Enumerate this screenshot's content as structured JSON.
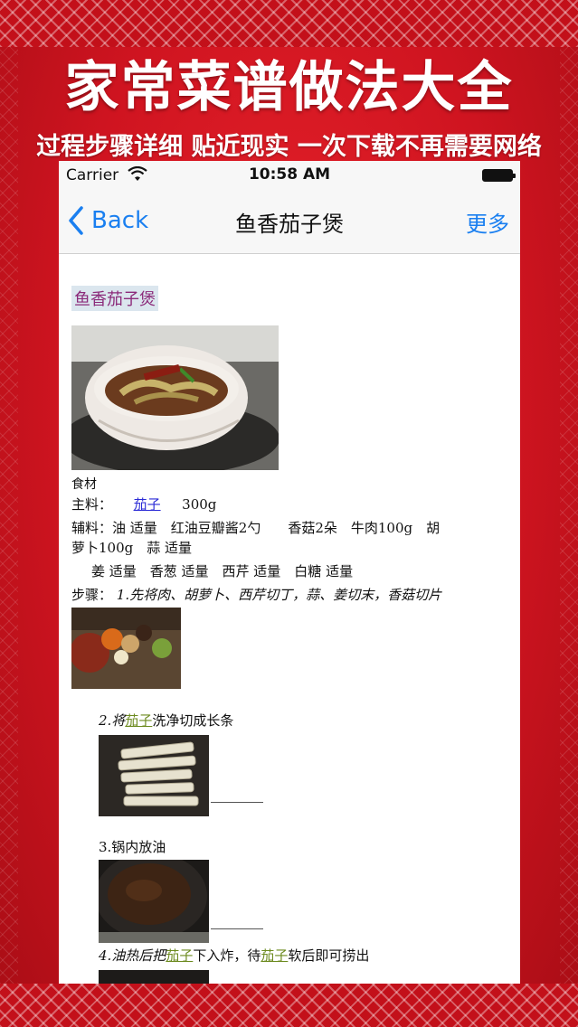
{
  "promo": {
    "title": "家常菜谱做法大全",
    "subtitle": "过程步骤详细 贴近现实 一次下载不再需要网络"
  },
  "status_bar": {
    "carrier": "Carrier",
    "time": "10:58 AM"
  },
  "nav": {
    "back_label": "Back",
    "title": "鱼香茄子煲",
    "more_label": "更多"
  },
  "recipe": {
    "heading": "鱼香茄子煲",
    "ingredients_label": "食材",
    "main_label": "主料：",
    "main_item": "茄子",
    "main_amount": "300g",
    "aux_line1": "辅料：油 适量　红油豆瓣酱2勺　　香菇2朵　牛肉100g　胡",
    "aux_line2": "萝卜100g　蒜 适量",
    "aux_line3": "姜 适量　香葱 适量　西芹 适量　白糖 适量",
    "steps_label": "步骤：",
    "step1": "1.先将肉、胡萝卜、西芹切丁，蒜、姜切末，香菇切片",
    "step2_prefix": "2.将",
    "step2_link": "茄子",
    "step2_suffix": "洗净切成长条",
    "step3": "3.锅内放油",
    "step4_prefix": "4.油热后把",
    "step4_link1": "茄子",
    "step4_middle": "下入炸，待",
    "step4_link2": "茄子",
    "step4_suffix": "软后即可捞出"
  },
  "colors": {
    "background_red": "#cf1420",
    "ios_blue": "#1a7ff0",
    "link_green": "#6c8a1f",
    "link_blue": "#2a2ad6",
    "heading_purple": "#8b2a7a"
  }
}
